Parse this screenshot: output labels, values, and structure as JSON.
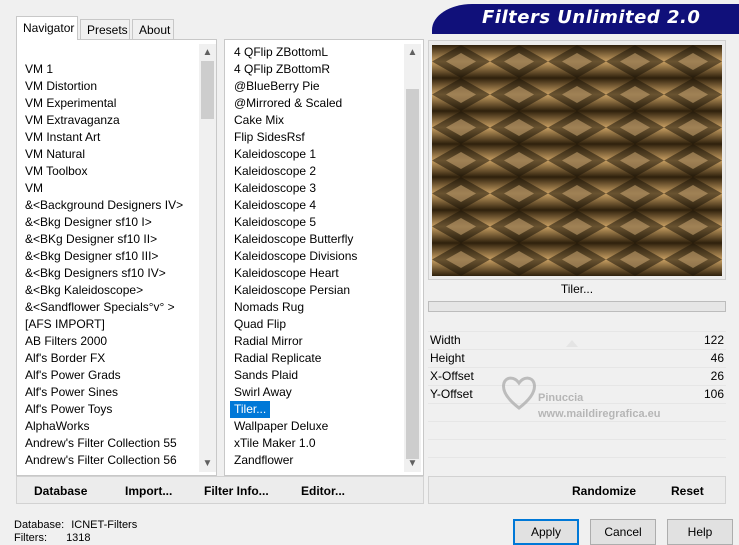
{
  "tabs": [
    "Navigator",
    "Presets",
    "About"
  ],
  "header_title": "Filters Unlimited 2.0",
  "categories": [
    "VM 1",
    "VM Distortion",
    "VM Experimental",
    "VM Extravaganza",
    "VM Instant Art",
    "VM Natural",
    "VM Toolbox",
    "VM",
    "&<Background Designers IV>",
    "&<Bkg Designer sf10 I>",
    "&<BKg Designer sf10 II>",
    "&<Bkg Designer sf10 III>",
    "&<Bkg Designers sf10 IV>",
    "&<Bkg Kaleidoscope>",
    "&<Sandflower Specials°v° >",
    "[AFS IMPORT]",
    "AB Filters 2000",
    "Alf's Border FX",
    "Alf's Power Grads",
    "Alf's Power Sines",
    "Alf's Power Toys",
    "AlphaWorks",
    "Andrew's Filter Collection 55",
    "Andrew's Filter Collection 56"
  ],
  "filters": [
    "4 QFlip ZBottomL",
    "4 QFlip ZBottomR",
    "@BlueBerry Pie",
    "@Mirrored & Scaled",
    "Cake Mix",
    "Flip SidesRsf",
    "Kaleidoscope 1",
    "Kaleidoscope 2",
    "Kaleidoscope 3",
    "Kaleidoscope 4",
    "Kaleidoscope 5",
    "Kaleidoscope Butterfly",
    "Kaleidoscope Divisions",
    "Kaleidoscope Heart",
    "Kaleidoscope Persian",
    "Nomads Rug",
    "Quad Flip",
    "Radial Mirror",
    "Radial Replicate",
    "Sands Plaid",
    "Swirl Away",
    "Tiler...",
    "Wallpaper Deluxe",
    "xTile Maker 1.0",
    "Zandflower"
  ],
  "selected_filter": "Tiler...",
  "preview_caption": "Tiler...",
  "params": [
    {
      "label": "Width",
      "value": "122"
    },
    {
      "label": "Height",
      "value": "46"
    },
    {
      "label": "X-Offset",
      "value": "26"
    },
    {
      "label": "Y-Offset",
      "value": "106"
    }
  ],
  "watermark": {
    "name": "Pinuccia",
    "url": "www.maildiregrafica.eu"
  },
  "left_buttons": {
    "database": "Database",
    "import": "Import...",
    "filter_info": "Filter Info...",
    "editor": "Editor..."
  },
  "right_buttons": {
    "randomize": "Randomize",
    "reset": "Reset"
  },
  "status": {
    "database_label": "Database:",
    "database_value": "ICNET-Filters",
    "filters_label": "Filters:",
    "filters_value": "1318"
  },
  "dialog_buttons": {
    "apply": "Apply",
    "cancel": "Cancel",
    "help": "Help"
  },
  "icons": {
    "scroll_up": "scroll-up-arrow-icon",
    "scroll_down": "scroll-down-arrow-icon"
  },
  "colors": {
    "selection": "#0078d7",
    "header_bg": "#10107a",
    "header_text": "#ffffff",
    "preview_dark": "#3a2a12",
    "preview_light": "#c9a063"
  }
}
